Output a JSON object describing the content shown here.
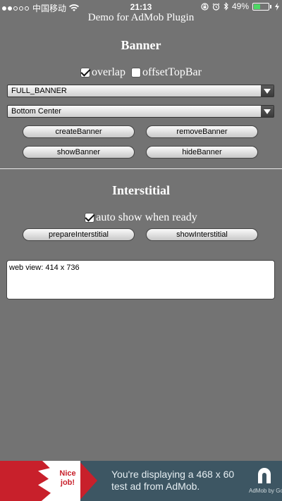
{
  "status_bar": {
    "carrier": "中国移动",
    "time": "21:13",
    "battery": "49%",
    "battery_level": 0.49,
    "signal_dots_filled": 2,
    "signal_dots_total": 5
  },
  "app": {
    "title": "Demo for AdMob Plugin"
  },
  "banner": {
    "heading": "Banner",
    "overlap_label": "overlap",
    "overlap_checked": true,
    "offset_label": "offsetTopBar",
    "offset_checked": false,
    "size_select": "FULL_BANNER",
    "position_select": "Bottom Center",
    "buttons": {
      "create": "createBanner",
      "remove": "removeBanner",
      "show": "showBanner",
      "hide": "hideBanner"
    }
  },
  "interstitial": {
    "heading": "Interstitial",
    "autoshow_label": "auto show when ready",
    "autoshow_checked": true,
    "buttons": {
      "prepare": "prepareInterstitial",
      "show": "showInterstitial"
    }
  },
  "log": {
    "text": "web view: 414 x 736"
  },
  "ad": {
    "badge": "Nice job!",
    "message_line1": "You're displaying a 468 x 60",
    "message_line2": "test ad from AdMob.",
    "brand": "AdMob by Goo",
    "colors": {
      "background": "#3d5663",
      "accent": "#c8202b"
    }
  }
}
